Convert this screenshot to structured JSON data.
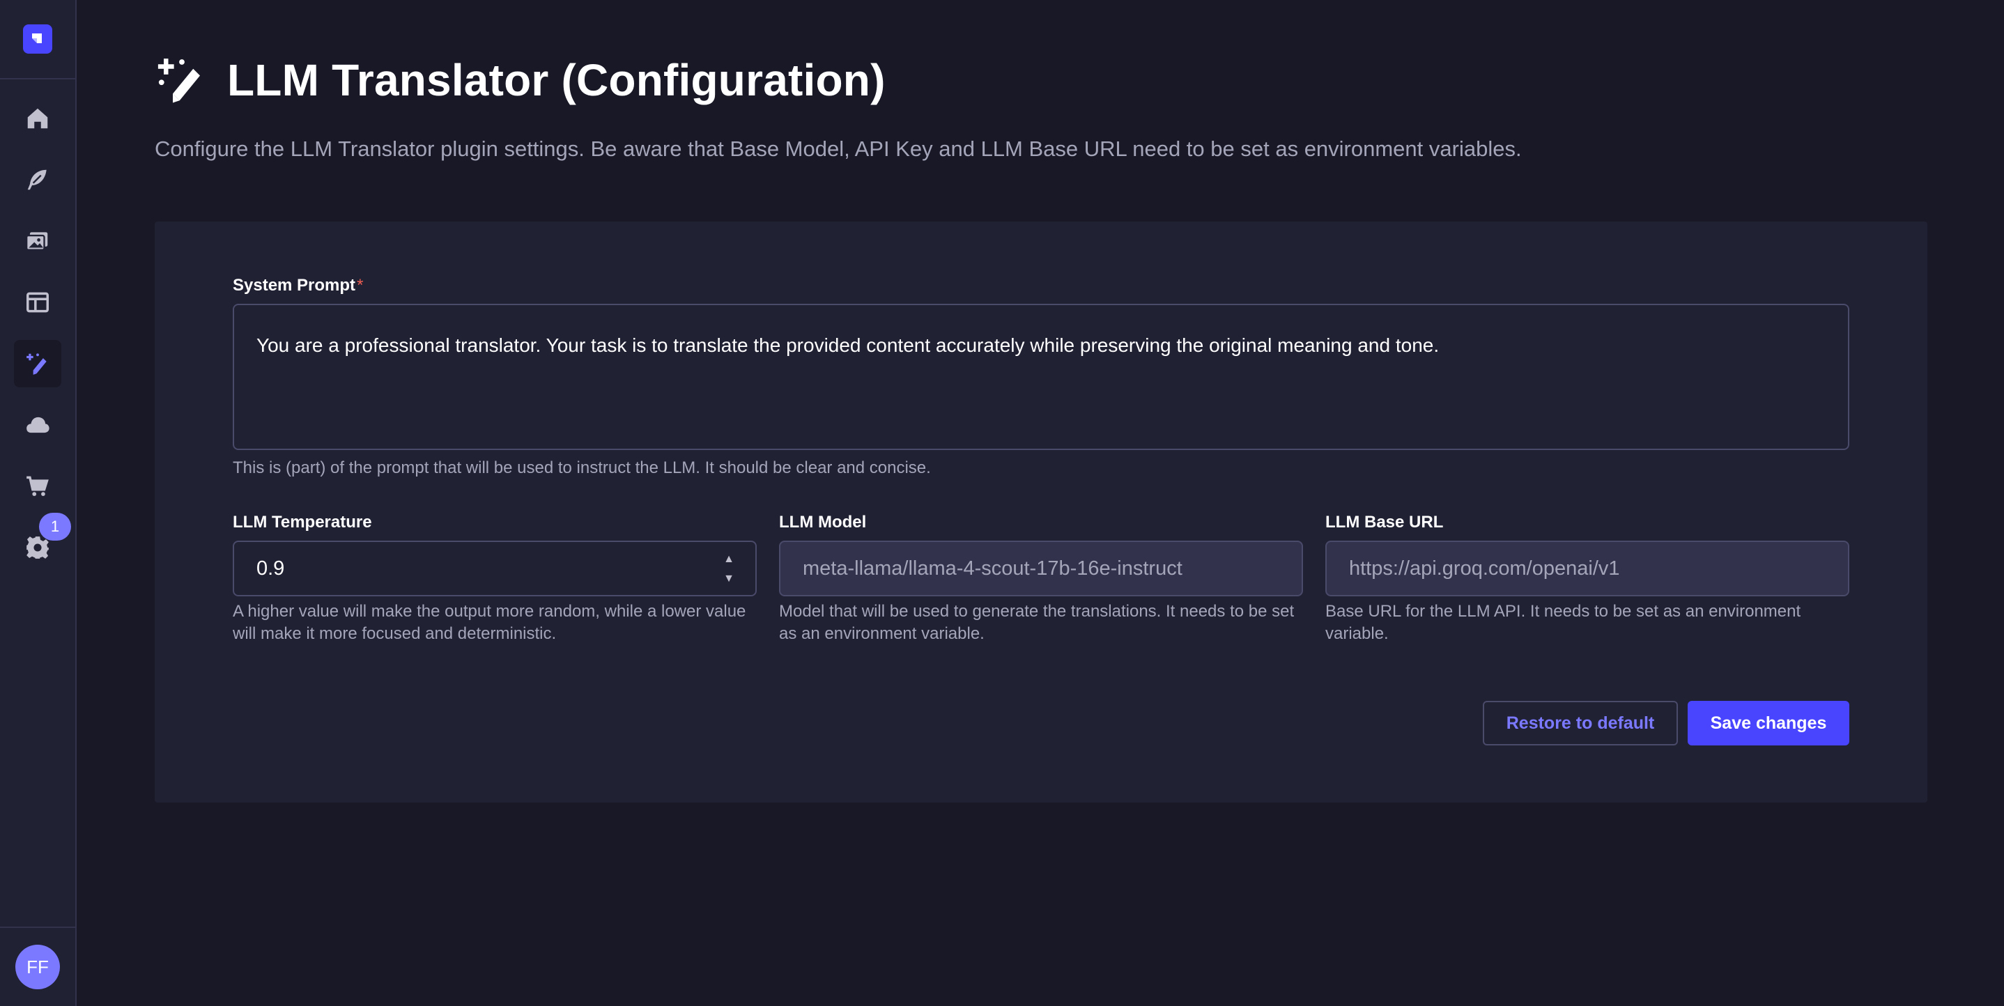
{
  "sidebar": {
    "items": [
      {
        "name": "home",
        "icon": "home-icon"
      },
      {
        "name": "content-manager",
        "icon": "feather-icon"
      },
      {
        "name": "media-library",
        "icon": "images-icon"
      },
      {
        "name": "content-type-builder",
        "icon": "layout-icon"
      },
      {
        "name": "llm-translator",
        "icon": "magic-wand-icon",
        "active": true
      },
      {
        "name": "cloud",
        "icon": "cloud-icon"
      },
      {
        "name": "marketplace",
        "icon": "cart-icon"
      },
      {
        "name": "settings",
        "icon": "gear-icon"
      }
    ],
    "settings_badge": "1",
    "user_initials": "FF"
  },
  "header": {
    "title": "LLM Translator (Configuration)",
    "subtitle": "Configure the LLM Translator plugin settings. Be aware that Base Model, API Key and LLM Base URL need to be set as environment variables."
  },
  "form": {
    "system_prompt": {
      "label": "System Prompt",
      "required_mark": "*",
      "value": "You are a professional translator. Your task is to translate the provided content accurately while preserving the original meaning and tone.",
      "hint": "This is (part) of the prompt that will be used to instruct the LLM. It should be clear and concise."
    },
    "temperature": {
      "label": "LLM Temperature",
      "value": "0.9",
      "hint": "A higher value will make the output more random, while a lower value will make it more focused and deterministic."
    },
    "model": {
      "label": "LLM Model",
      "value": "meta-llama/llama-4-scout-17b-16e-instruct",
      "hint": "Model that will be used to generate the translations. It needs to be set as an environment variable."
    },
    "base_url": {
      "label": "LLM Base URL",
      "value": "https://api.groq.com/openai/v1",
      "hint": "Base URL for the LLM API. It needs to be set as an environment variable."
    },
    "restore_label": "Restore to default",
    "save_label": "Save changes"
  },
  "colors": {
    "background": "#181826",
    "surface": "#212134",
    "accent": "#4945ff",
    "accent_light": "#7b79ff",
    "muted_text": "#a5a5ba",
    "border": "#4a4a6a"
  }
}
